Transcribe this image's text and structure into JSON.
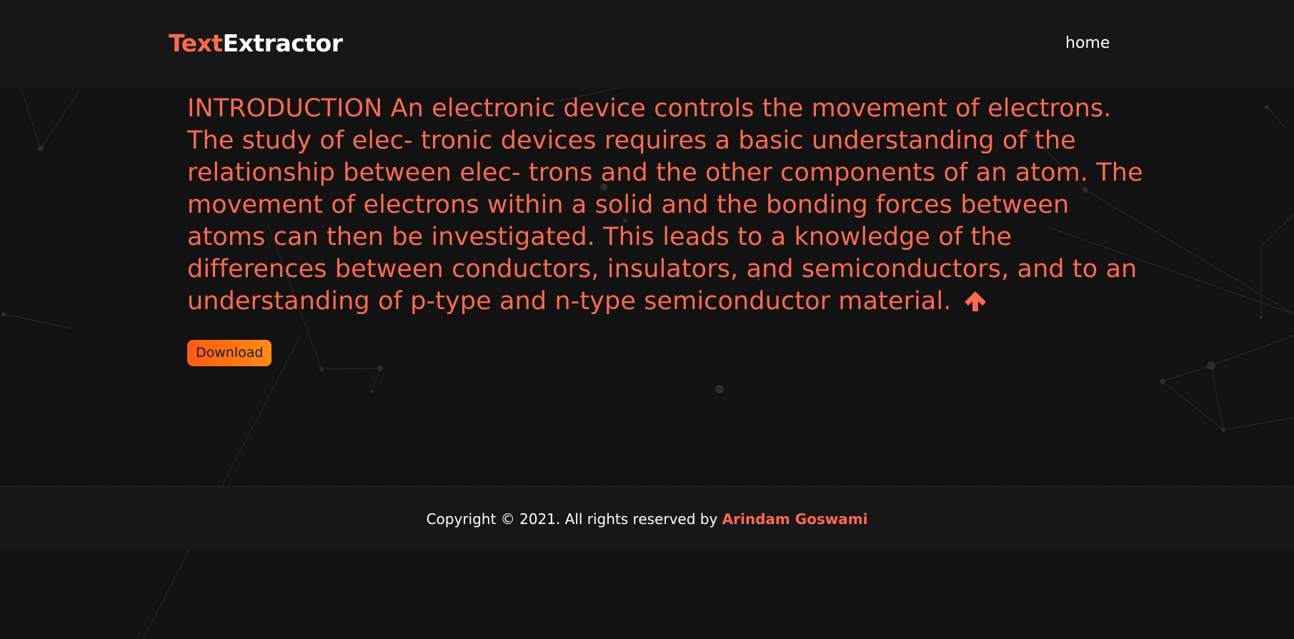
{
  "header": {
    "brand_part_a": "Text",
    "brand_part_b": "Extractor",
    "nav_home": "home"
  },
  "main": {
    "extracted_text": "INTRODUCTION An electronic device controls the movement of electrons. The study of elec- tronic devices requires a basic understanding of the relationship between elec- trons and the other components of an atom. The movement of electrons within a solid and the bonding forces between atoms can then be investigated. This leads to a knowledge of the differences between conductors, insulators, and semiconductors, and to an understanding of p-type and n-type semiconductor material.",
    "scroll_icon": "arrow-up-icon",
    "download_label": "Download"
  },
  "footer": {
    "copyright_prefix": "Copyright © 2021. All rights reserved by",
    "author": "Arindam Goswami"
  },
  "colors": {
    "accent": "#ff6a4d",
    "background": "#121212",
    "header_footer_bg": "#171717",
    "button_gradient_start": "#ff5a14",
    "button_gradient_end": "#ff8c14"
  }
}
